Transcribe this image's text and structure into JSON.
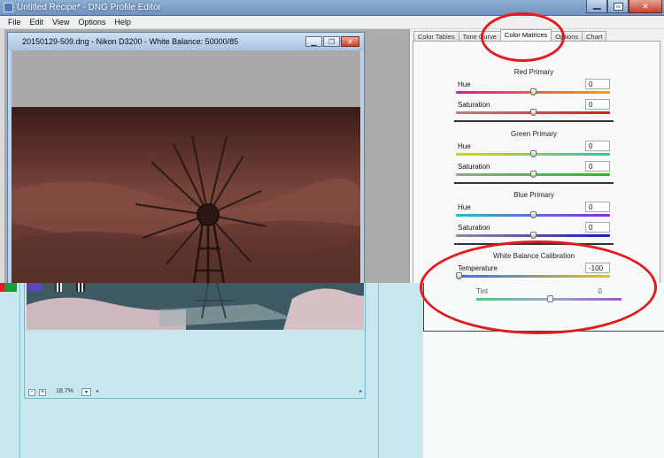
{
  "window": {
    "title": "Untitled Recipe* - DNG Profile Editor"
  },
  "menu": {
    "items": [
      "File",
      "Edit",
      "View",
      "Options",
      "Help"
    ]
  },
  "image_window": {
    "title": "20150129-509.dng  - Nikon D3200 - White Balance: 50000/85"
  },
  "tabs": [
    {
      "label": "Color Tables",
      "active": false
    },
    {
      "label": "Tone Curve",
      "active": false
    },
    {
      "label": "Color Matrices",
      "active": true
    },
    {
      "label": "Options",
      "active": false
    },
    {
      "label": "Chart",
      "active": false
    }
  ],
  "groups": [
    {
      "title": "Red Primary",
      "sliders": [
        {
          "label": "Hue",
          "value": "0",
          "gradient": [
            "#c5268b",
            "#e0a530"
          ],
          "position": 0.5
        },
        {
          "label": "Saturation",
          "value": "0",
          "gradient": [
            "#aa8787",
            "#d01e1e"
          ],
          "position": 0.5
        }
      ]
    },
    {
      "title": "Green Primary",
      "sliders": [
        {
          "label": "Hue",
          "value": "0",
          "gradient": [
            "#d8d02a",
            "#37c0a6"
          ],
          "position": 0.5
        },
        {
          "label": "Saturation",
          "value": "0",
          "gradient": [
            "#8fa78f",
            "#2fb52f"
          ],
          "position": 0.5
        }
      ]
    },
    {
      "title": "Blue Primary",
      "sliders": [
        {
          "label": "Hue",
          "value": "0",
          "gradient": [
            "#2ab5d2",
            "#8a2bd4"
          ],
          "position": 0.5
        },
        {
          "label": "Saturation",
          "value": "0",
          "gradient": [
            "#8c8ca8",
            "#1a1ab5"
          ],
          "position": 0.5
        }
      ]
    },
    {
      "title": "White Balance Calibration",
      "sliders": [
        {
          "label": "Temperature",
          "value": "-100",
          "gradient": [
            "#3b6fd6",
            "#e0c03a"
          ],
          "position": 0.0
        }
      ]
    }
  ],
  "tint": {
    "label": "Tint",
    "value": "0"
  },
  "status": {
    "zoom_minus": "-",
    "zoom_plus": "+",
    "zoom": "18.7%",
    "zoom_dropdown": "▾"
  }
}
